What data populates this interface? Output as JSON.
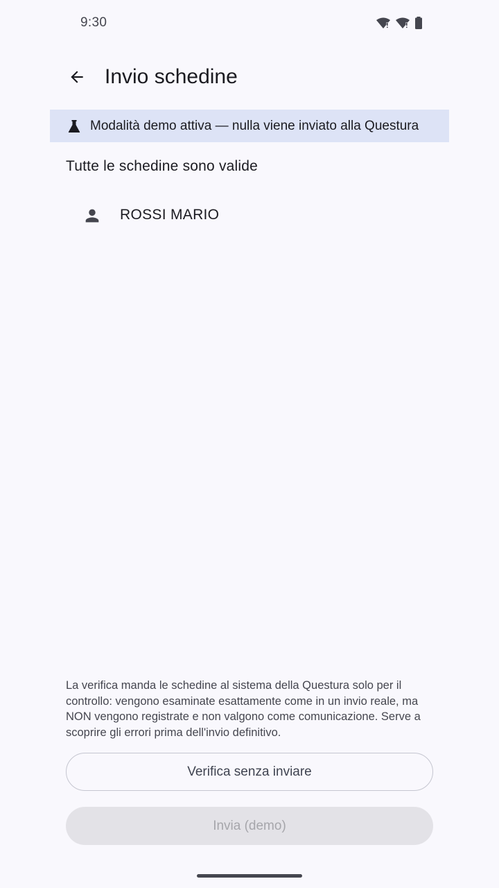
{
  "status_bar": {
    "time": "9:30",
    "icons": [
      "wifi-alert-icon",
      "wifi-alert-icon",
      "battery-icon"
    ]
  },
  "top_bar": {
    "back_icon": "arrow-back-icon",
    "title": "Invio schedine"
  },
  "demo_banner": {
    "icon": "flask-icon",
    "text": "Modalità demo attiva — nulla viene inviato alla Questura"
  },
  "main": {
    "status_message": "Tutte le schedine sono valide",
    "guests": [
      {
        "icon": "person-icon",
        "name": "ROSSI MARIO"
      }
    ]
  },
  "footer": {
    "info": "La verifica manda le schedine al sistema della Questura solo per il controllo: vengono esaminate esattamente come in un invio reale, ma NON vengono registrate e non valgono come comunicazione. Serve a scoprire gli errori prima dell'invio definitivo.",
    "verify_button": "Verifica senza inviare",
    "send_button": "Invia (demo)"
  },
  "colors": {
    "background": "#f9f8fd",
    "banner": "#dde3f6",
    "disabled_button": "#e3e2e7"
  }
}
